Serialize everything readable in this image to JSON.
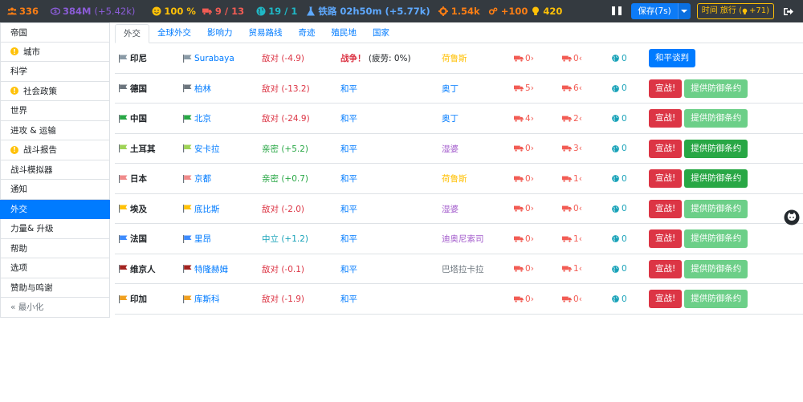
{
  "topbar": {
    "population": "336",
    "money": "384M",
    "money_rate": "(+5.42k)",
    "happiness": "100 %",
    "supply": "9 / 13",
    "influence": "19 / 1",
    "research": "铁路 02h50m (+5.77k)",
    "industry": "1.54k",
    "production": "+100",
    "ideas": "420",
    "save_label": "保存(7s)",
    "time_label": "时间 旅行 (",
    "time_value": "+71)"
  },
  "sidebar": {
    "items": [
      {
        "label": "帝国",
        "warn": false,
        "active": false
      },
      {
        "label": "城市",
        "warn": true,
        "active": false
      },
      {
        "label": "科学",
        "warn": false,
        "active": false
      },
      {
        "label": "社会政策",
        "warn": true,
        "active": false
      },
      {
        "label": "世界",
        "warn": false,
        "active": false
      },
      {
        "label": "进攻 & 运输",
        "warn": false,
        "active": false
      },
      {
        "label": "战斗报告",
        "warn": true,
        "active": false
      },
      {
        "label": "战斗模拟器",
        "warn": false,
        "active": false
      },
      {
        "label": "通知",
        "warn": false,
        "active": false
      },
      {
        "label": "外交",
        "warn": false,
        "active": true
      },
      {
        "label": "力量& 升级",
        "warn": false,
        "active": false
      },
      {
        "label": "帮助",
        "warn": false,
        "active": false
      },
      {
        "label": "选项",
        "warn": false,
        "active": false
      },
      {
        "label": "赞助与鸣谢",
        "warn": false,
        "active": false
      }
    ],
    "minimize_label": "« 最小化"
  },
  "tabs": [
    "外交",
    "全球外交",
    "影响力",
    "贸易路线",
    "奇迹",
    "殖民地",
    "国家"
  ],
  "nations": [
    {
      "name": "印尼",
      "city": "Surabaya",
      "rel": "敌对 (-4.9)",
      "rel_type": "hostile",
      "status": "战争！",
      "status_sub": "(疲劳: 0%)",
      "gov": "荷鲁斯",
      "gov_color": "#ffc107",
      "u1": "0",
      "u2": "0",
      "inf": "0",
      "flag_color": "#8a9aa6",
      "buttons": [
        {
          "label": "和平谈判",
          "style": "btn-primary"
        }
      ]
    },
    {
      "name": "德国",
      "city": "柏林",
      "rel": "敌对 (-13.2)",
      "rel_type": "hostile",
      "status": "和平",
      "status_sub": "",
      "gov": "奥丁",
      "gov_color": "#007bff",
      "u1": "5",
      "u2": "6",
      "inf": "0",
      "flag_color": "#6c757d",
      "buttons": [
        {
          "label": "宣战!",
          "style": "btn-danger"
        },
        {
          "label": "提供防御条约",
          "style": "btn-success-light"
        }
      ]
    },
    {
      "name": "中国",
      "city": "北京",
      "rel": "敌对 (-24.9)",
      "rel_type": "hostile",
      "status": "和平",
      "status_sub": "",
      "gov": "奥丁",
      "gov_color": "#007bff",
      "u1": "4",
      "u2": "2",
      "inf": "0",
      "flag_color": "#28a745",
      "buttons": [
        {
          "label": "宣战!",
          "style": "btn-danger"
        },
        {
          "label": "提供防御条约",
          "style": "btn-success-light"
        }
      ]
    },
    {
      "name": "土耳其",
      "city": "安卡拉",
      "rel": "亲密 (+5.2)",
      "rel_type": "friendly",
      "status": "和平",
      "status_sub": "",
      "gov": "湿婆",
      "gov_color": "#a35ccc",
      "u1": "0",
      "u2": "3",
      "inf": "0",
      "flag_color": "#9fd356",
      "buttons": [
        {
          "label": "宣战!",
          "style": "btn-danger"
        },
        {
          "label": "提供防御条约",
          "style": "btn-success"
        }
      ]
    },
    {
      "name": "日本",
      "city": "京都",
      "rel": "亲密 (+0.7)",
      "rel_type": "friendly",
      "status": "和平",
      "status_sub": "",
      "gov": "荷鲁斯",
      "gov_color": "#ffc107",
      "u1": "0",
      "u2": "1",
      "inf": "0",
      "flag_color": "#f08a8a",
      "buttons": [
        {
          "label": "宣战!",
          "style": "btn-danger"
        },
        {
          "label": "提供防御条约",
          "style": "btn-success"
        }
      ]
    },
    {
      "name": "埃及",
      "city": "底比斯",
      "rel": "敌对 (-2.0)",
      "rel_type": "hostile",
      "status": "和平",
      "status_sub": "",
      "gov": "湿婆",
      "gov_color": "#a35ccc",
      "u1": "0",
      "u2": "0",
      "inf": "0",
      "flag_color": "#ffc107",
      "buttons": [
        {
          "label": "宣战!",
          "style": "btn-danger"
        },
        {
          "label": "提供防御条约",
          "style": "btn-success-light"
        }
      ]
    },
    {
      "name": "法国",
      "city": "里昂",
      "rel": "中立 (+1.2)",
      "rel_type": "neutral",
      "status": "和平",
      "status_sub": "",
      "gov": "迪奥尼索司",
      "gov_color": "#a35ccc",
      "u1": "0",
      "u2": "1",
      "inf": "0",
      "flag_color": "#3d8bfd",
      "buttons": [
        {
          "label": "宣战!",
          "style": "btn-danger"
        },
        {
          "label": "提供防御条约",
          "style": "btn-success-light"
        }
      ]
    },
    {
      "name": "维京人",
      "city": "特隆赫姆",
      "rel": "敌对 (-0.1)",
      "rel_type": "hostile",
      "status": "和平",
      "status_sub": "",
      "gov": "巴塔拉卡拉",
      "gov_color": "#6c757d",
      "u1": "0",
      "u2": "1",
      "inf": "0",
      "flag_color": "#a3231f",
      "buttons": [
        {
          "label": "宣战!",
          "style": "btn-danger"
        },
        {
          "label": "提供防御条约",
          "style": "btn-success-light"
        }
      ]
    },
    {
      "name": "印加",
      "city": "库斯科",
      "rel": "敌对 (-1.9)",
      "rel_type": "hostile",
      "status": "和平",
      "status_sub": "",
      "gov": "",
      "gov_color": "#6c757d",
      "u1": "0",
      "u2": "0",
      "inf": "0",
      "flag_color": "#f0a020",
      "buttons": [
        {
          "label": "宣战!",
          "style": "btn-danger"
        },
        {
          "label": "提供防御条约",
          "style": "btn-success-light"
        }
      ]
    }
  ]
}
